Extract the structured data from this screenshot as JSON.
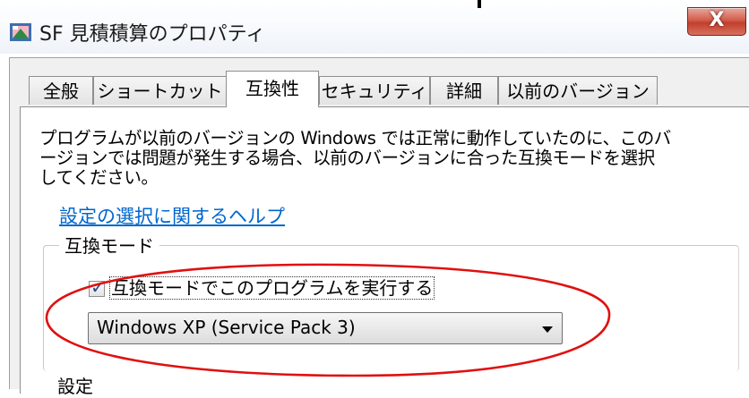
{
  "window": {
    "title": "SF 見積積算のプロパティ",
    "close_glyph": "X"
  },
  "tabs": [
    {
      "label": "全般"
    },
    {
      "label": "ショートカット"
    },
    {
      "label": "互換性",
      "active": true
    },
    {
      "label": "セキュリティ"
    },
    {
      "label": "詳細"
    },
    {
      "label": "以前のバージョン"
    }
  ],
  "compat": {
    "description_line1": "プログラムが以前のバージョンの Windows では正常に動作していたのに、このバ",
    "description_line2": "ージョンでは問題が発生する場合、以前のバージョンに合った互換モードを選択",
    "description_line3": "してください。",
    "help_link": "設定の選択に関するヘルプ",
    "group_label": "互換モード",
    "checkbox_label": "互換モードでこのプログラムを実行する",
    "checkbox_checked": true,
    "checkbox_mark": "✓",
    "os_selected": "Windows XP (Service Pack 3)",
    "settings_label_partial": "設定"
  },
  "annotation": {
    "ellipse_color": "#e01010"
  }
}
